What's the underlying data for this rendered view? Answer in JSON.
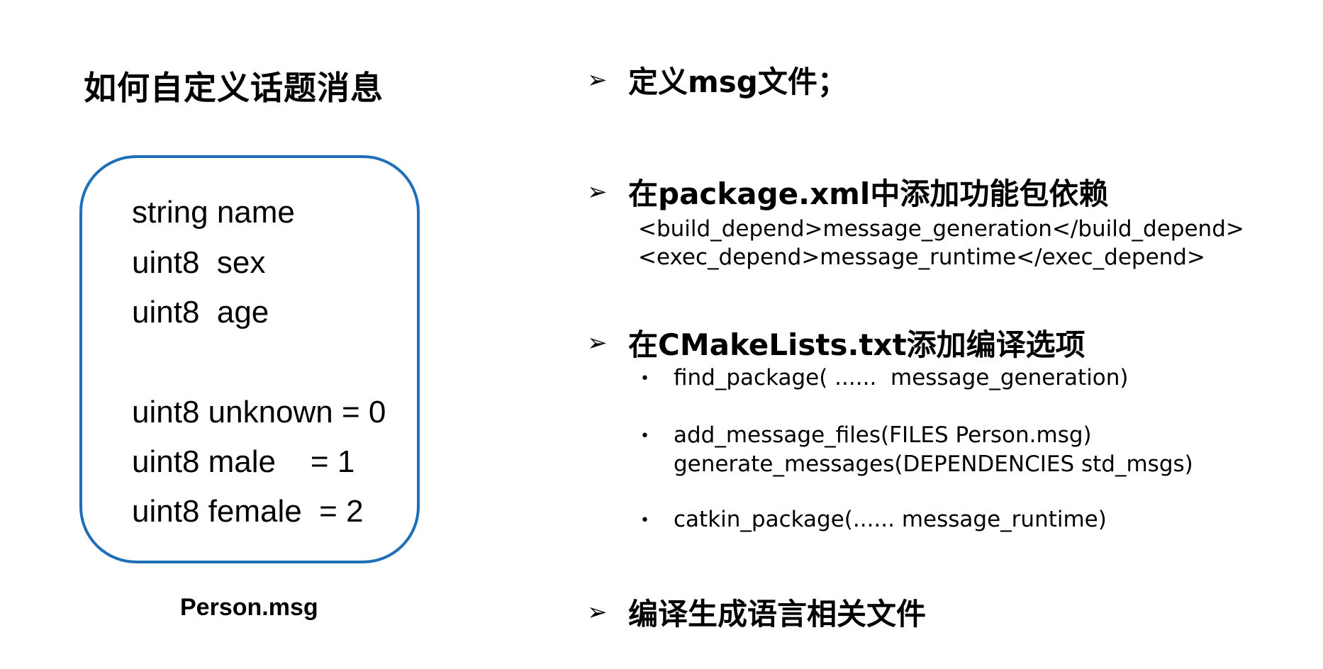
{
  "title": "如何自定义话题消息",
  "message_box": {
    "lines": [
      "string name",
      "uint8  sex",
      "uint8  age",
      "uint8 unknown = 0",
      "uint8 male    = 1",
      "uint8 female  = 2"
    ],
    "caption": "Person.msg",
    "border_color": "#1F6FB8"
  },
  "steps": [
    {
      "marker": "➢",
      "label": "定义msg文件；"
    },
    {
      "marker": "➢",
      "label": "在package.xml中添加功能包依赖",
      "code_lines": [
        "<build_depend>message_generation</build_depend>",
        "<exec_depend>message_runtime</exec_depend>"
      ]
    },
    {
      "marker": "➢",
      "label": "在CMakeLists.txt添加编译选项",
      "bullets": [
        {
          "marker": "•",
          "lines": [
            "find_package( ......  message_generation)"
          ]
        },
        {
          "marker": "•",
          "lines": [
            "add_message_files(FILES Person.msg)",
            "generate_messages(DEPENDENCIES std_msgs)"
          ]
        },
        {
          "marker": "•",
          "lines": [
            "catkin_package(...... message_runtime)"
          ]
        }
      ]
    },
    {
      "marker": "➢",
      "label": "编译生成语言相关文件"
    }
  ]
}
